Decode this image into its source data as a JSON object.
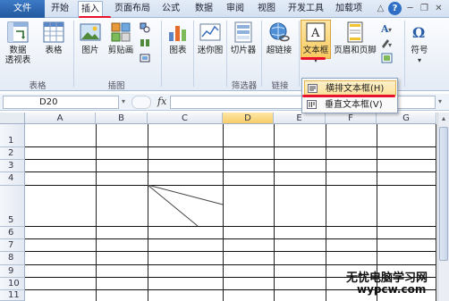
{
  "tabs": [
    {
      "label": "文件"
    },
    {
      "label": "开始"
    },
    {
      "label": "插入"
    },
    {
      "label": "页面布局"
    },
    {
      "label": "公式"
    },
    {
      "label": "数据"
    },
    {
      "label": "审阅"
    },
    {
      "label": "视图"
    },
    {
      "label": "开发工具"
    },
    {
      "label": "加载项"
    }
  ],
  "active_tab": "插入",
  "ribbon": {
    "pivot_label_1": "数据",
    "pivot_label_2": "透视表",
    "table_label": "表格",
    "picture_label": "图片",
    "clipart_label": "剪贴画",
    "chart_label": "图表",
    "sparkline_label": "迷你图",
    "slicer_label": "切片器",
    "hyperlink_label": "超链接",
    "textbox_label": "文本框",
    "headerfooter_label": "页眉和页脚",
    "symbol_label": "符号",
    "groups": {
      "tables": "表格",
      "illustrations": "插图",
      "filter": "筛选器",
      "links": "链接"
    }
  },
  "dropdown": {
    "items": [
      {
        "label": "横排文本框(H)"
      },
      {
        "label": "垂直文本框(V)"
      }
    ]
  },
  "formula_bar": {
    "name_box": "D20",
    "fx": "fx",
    "value": ""
  },
  "grid": {
    "columns": [
      "A",
      "B",
      "C",
      "D",
      "E",
      "F",
      "G"
    ],
    "selected_column": "D",
    "rows": [
      "1",
      "2",
      "3",
      "4",
      "5",
      "6",
      "7",
      "8",
      "9",
      "10",
      "11"
    ]
  },
  "watermark": {
    "line1": "无忧电脑学习网",
    "line2": "wypcw.com"
  },
  "colors": {
    "accent": "#2a5fa8",
    "highlight": "#f8c95e",
    "annotation": "#e8102a"
  }
}
